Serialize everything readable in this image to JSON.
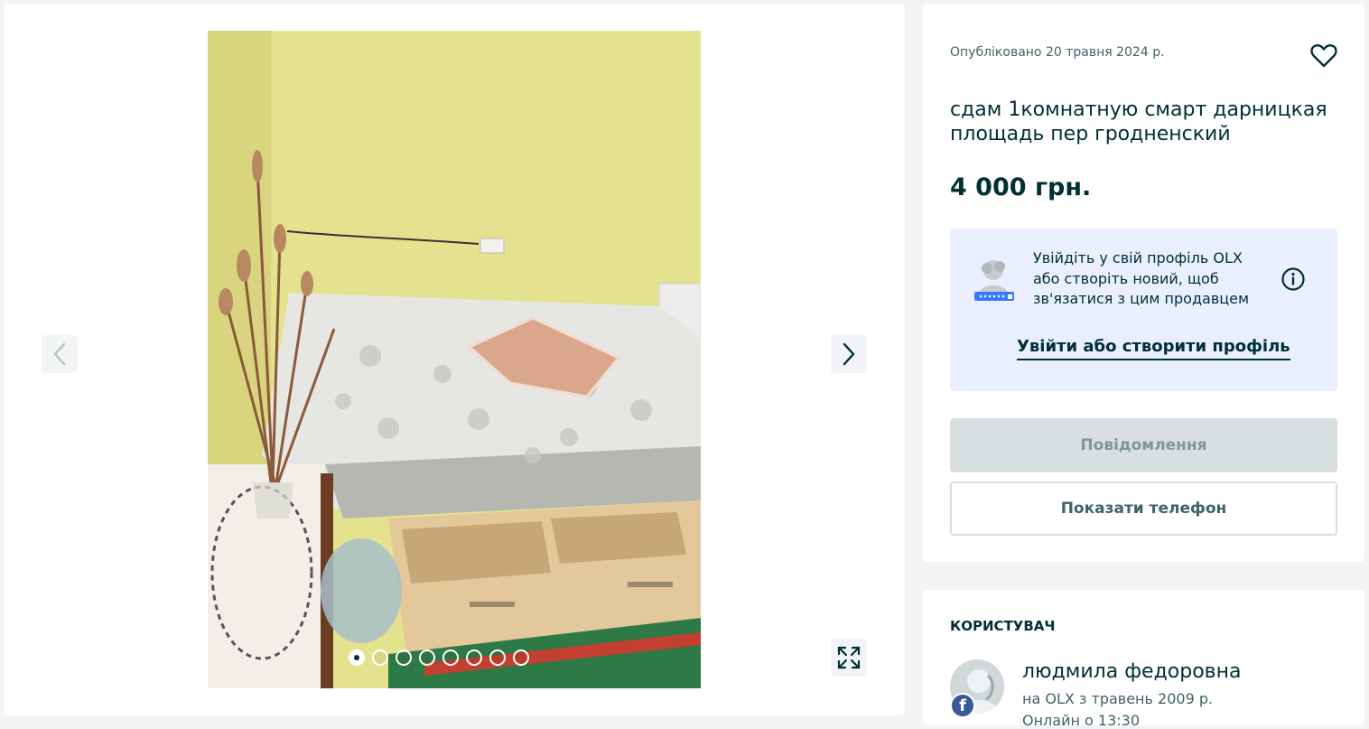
{
  "gallery": {
    "photo_count": 8,
    "active_index": 0
  },
  "ad": {
    "posted": "Опубліковано 20 травня 2024 р.",
    "title": "сдам 1комнатную смарт дарницкая площадь пер гродненский",
    "price": "4 000 грн."
  },
  "login_prompt": {
    "text": "Увійдіть у свій профіль OLX або створіть новий, щоб зв'язатися з цим продавцем",
    "link": "Увійти або створити профіль"
  },
  "actions": {
    "message": "Повідомлення",
    "show_phone": "Показати телефон"
  },
  "user": {
    "heading": "КОРИСТУВАЧ",
    "name": "людмила федоровна",
    "since": "на OLX з травень 2009 р.",
    "online": "Онлайн о 13:30"
  },
  "colors": {
    "primary": "#002f34",
    "secondary_text": "#406367",
    "login_bg": "#e9effe",
    "disabled_btn": "#d8dfe0"
  }
}
